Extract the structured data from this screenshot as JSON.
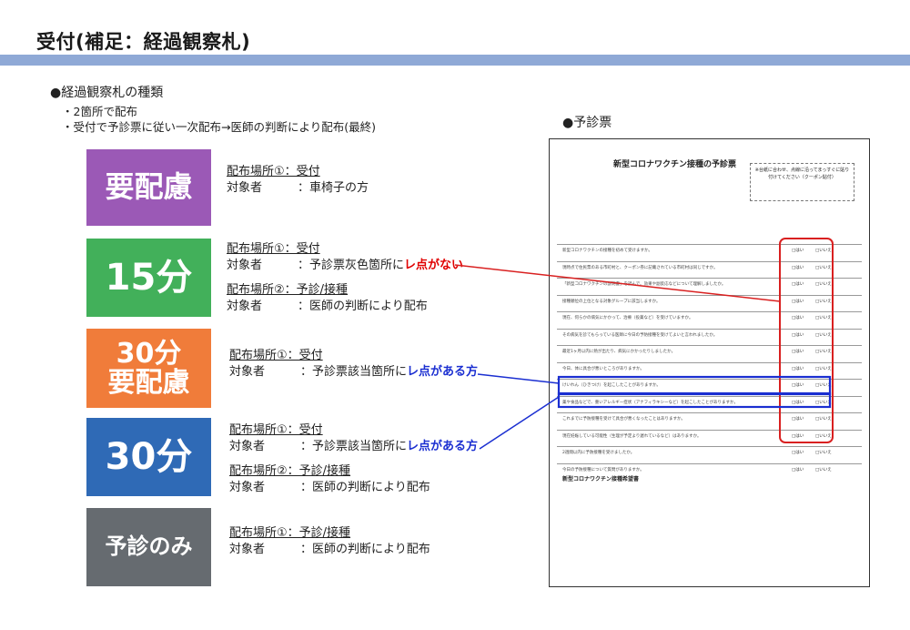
{
  "title": "受付(補足：経過観察札)",
  "heading": "●経過観察札の種類",
  "bullets": [
    "・2箇所で配布",
    "・受付で予診票に従い一次配布→医師の判断により配布(最終)"
  ],
  "form_label": "●予診票",
  "badges": [
    {
      "label": "要配慮",
      "color": "#9b59b6"
    },
    {
      "label": "15分",
      "color": "#42b05a"
    },
    {
      "label": "30分\n要配慮",
      "color": "#f07c3a"
    },
    {
      "label": "30分",
      "color": "#2f6ab6"
    },
    {
      "label": "予診のみ",
      "color": "#666b70"
    }
  ],
  "groups": {
    "g1": {
      "place1": "配布場所①：受付",
      "target_label": "対象者",
      "target1": "：車椅子の方"
    },
    "g2": {
      "place1": "配布場所①：受付",
      "target_label": "対象者",
      "target1_pre": "：予診票灰色箇所に",
      "target1_hl": "レ点がない",
      "place2": "配布場所②：予診/接種",
      "target2": "：医師の判断により配布"
    },
    "g3": {
      "place1": "配布場所①：受付",
      "target_label": "対象者",
      "target1_pre": "：予診票該当箇所に",
      "target1_hl": "レ点がある方"
    },
    "g4": {
      "place1": "配布場所①：受付",
      "target_label": "対象者",
      "target1_pre": "：予診票該当箇所に",
      "target1_hl": "レ点がある方",
      "place2": "配布場所②：予診/接種",
      "target2": "：医師の判断により配布"
    },
    "g5": {
      "place1": "配布場所①：予診/接種",
      "target_label": "対象者",
      "target1": "：医師の判断により配布"
    }
  },
  "document": {
    "title": "新型コロナワクチン接種の予診票",
    "coupon": "※台紙に合わせ、点線に沿ってまっすぐに貼り付けてください（クーポン貼付）",
    "questions": [
      "新型コロナワクチンの接種を初めて受けますか。",
      "現時点で住民票のある市町村と、クーポン券に記載されている市町村は同じですか。",
      "「新型コロナワクチンの説明書」を読んで、効果や副反応などについて理解しましたか。",
      "接種順位の上位となる対象グループに該当しますか。",
      "現在、何らかの病気にかかって、治療（投薬など）を受けていますか。",
      "その病気を診てもらっている医師に今日の予防接種を受けてよいと言われましたか。",
      "最近1ヶ月以内に熱が出たり、病気にかかったりしましたか。",
      "今日、体に具合が悪いところがありますか。",
      "けいれん（ひきつけ）を起こしたことがありますか。",
      "薬や食品などで、重いアレルギー症状（アナフィラキシーなど）を起こしたことがありますか。",
      "これまでに予防接種を受けて具合が悪くなったことはありますか。",
      "現在妊娠している可能性（生理が予定より遅れているなど）はありますか。",
      "2週間以内に予防接種を受けましたか。",
      "今日の予防接種について質問がありますか。"
    ],
    "yes": "はい",
    "no": "いいえ",
    "doctor_section": "新型コロナワクチン接種希望書"
  }
}
